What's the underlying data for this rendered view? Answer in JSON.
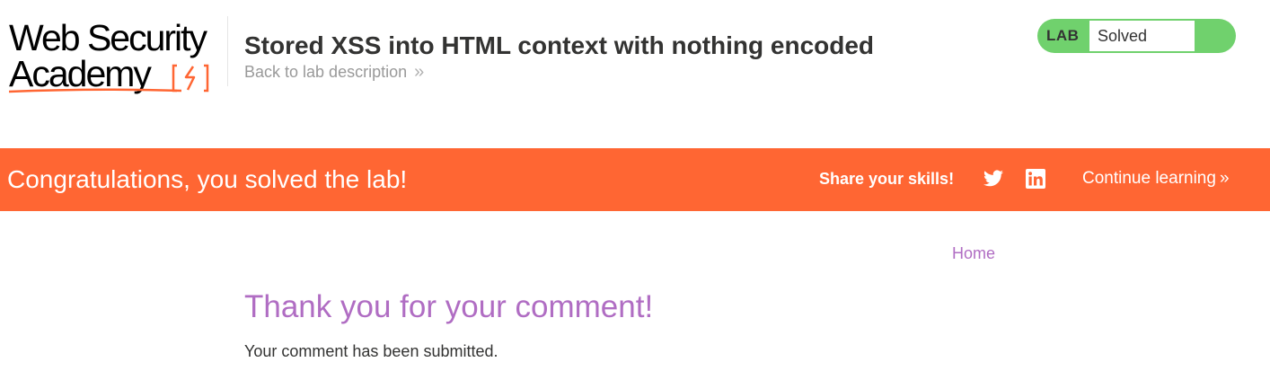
{
  "header": {
    "logo": {
      "line1": "Web Security",
      "line2": "Academy"
    },
    "lab_title": "Stored XSS into HTML context with nothing encoded",
    "back_link": "Back to lab description",
    "status": {
      "badge_label": "LAB",
      "status_text": "Solved",
      "color": "#70d16d"
    }
  },
  "banner": {
    "message": "Congratulations, you solved the lab!",
    "share_label": "Share your skills!",
    "share_icons": [
      "twitter-icon",
      "linkedin-icon"
    ],
    "continue_label": "Continue learning",
    "background": "#ff6633"
  },
  "nav": {
    "home_label": "Home"
  },
  "main": {
    "heading": "Thank you for your comment!",
    "message": "Your comment has been submitted.",
    "accent_color": "#b06dc3"
  },
  "icons": {
    "back_chevron": "»",
    "continue_chevron": "»"
  }
}
